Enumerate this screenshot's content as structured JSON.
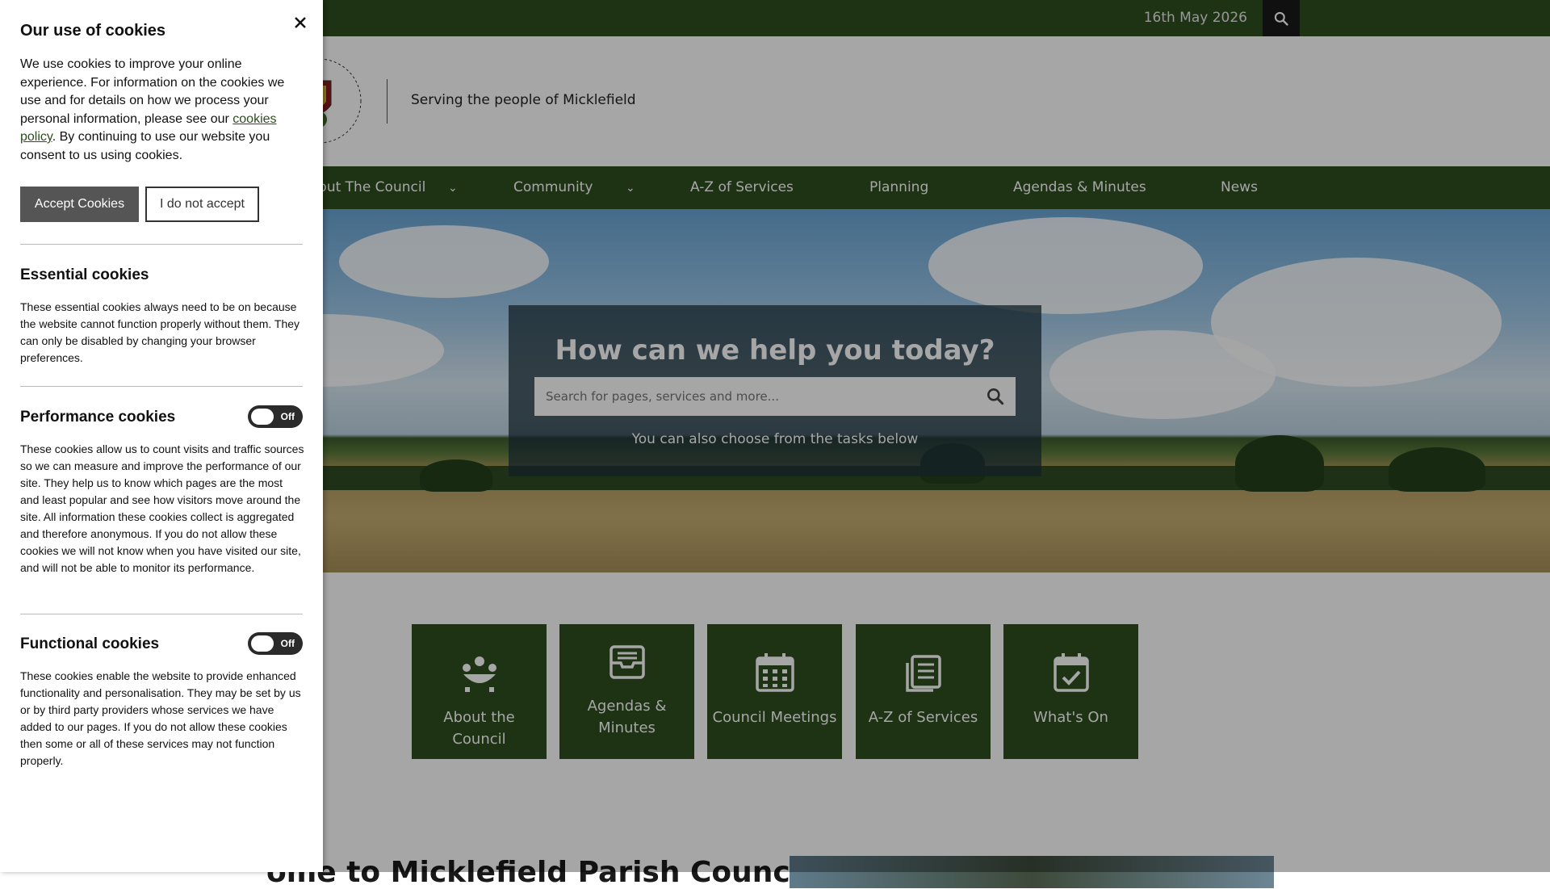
{
  "header": {
    "date": "16th May 2026",
    "search_icon": "search-icon",
    "tagline": "Serving the people of Micklefield"
  },
  "nav": {
    "items": [
      {
        "label": "About The Council",
        "has_dropdown": true
      },
      {
        "label": "Community",
        "has_dropdown": true
      },
      {
        "label": "A-Z of Services",
        "has_dropdown": false
      },
      {
        "label": "Planning",
        "has_dropdown": false
      },
      {
        "label": "Agendas & Minutes",
        "has_dropdown": false
      },
      {
        "label": "News",
        "has_dropdown": false
      }
    ]
  },
  "hero": {
    "title": "How can we help you today?",
    "search_placeholder": "Search for pages, services and more...",
    "subtitle": "You can also choose from the tasks below"
  },
  "tiles": [
    {
      "label": "About the Council",
      "icon": "council-icon"
    },
    {
      "label": "Agendas & Minutes",
      "icon": "inbox-icon"
    },
    {
      "label": "Council Meetings",
      "icon": "calendar-icon"
    },
    {
      "label": "A-Z of Services",
      "icon": "documents-icon"
    },
    {
      "label": "What's On",
      "icon": "calendar-check-icon"
    }
  ],
  "welcome": {
    "heading": "ome to Micklefield Parish Council"
  },
  "cookie_panel": {
    "title": "Our use of cookies",
    "intro_before_link": "We use cookies to improve your online experience. For information on the cookies we use and for details on how we process your personal information, please see our ",
    "intro_link": "cookies policy",
    "intro_after_link": ". By continuing to use our website you consent to us using cookies.",
    "accept_label": "Accept Cookies",
    "reject_label": "I do not accept",
    "sections": [
      {
        "heading": "Essential cookies",
        "text": "These essential cookies always need to be on because the website cannot function properly without them. They can only be disabled by changing your browser preferences."
      },
      {
        "heading": "Performance cookies",
        "toggle": "Off",
        "text": "These cookies allow us to count visits and traffic sources so we can measure and improve the performance of our site. They help us to know which pages are the most and least popular and see how visitors move around the site. All information these cookies collect is aggregated and therefore anonymous. If you do not allow these cookies we will not know when you have visited our site, and will not be able to monitor its performance."
      },
      {
        "heading": "Functional cookies",
        "toggle": "Off",
        "text": "These cookies enable the website to provide enhanced functionality and personalisation. They may be set by us or by third party providers whose services we have added to our pages. If you do not allow these cookies then some or all of these services may not function properly."
      }
    ]
  },
  "colors": {
    "brand_green": "#2e4d1f",
    "overlay": "rgba(0,0,0,0.35)",
    "accept_button": "#555555"
  }
}
